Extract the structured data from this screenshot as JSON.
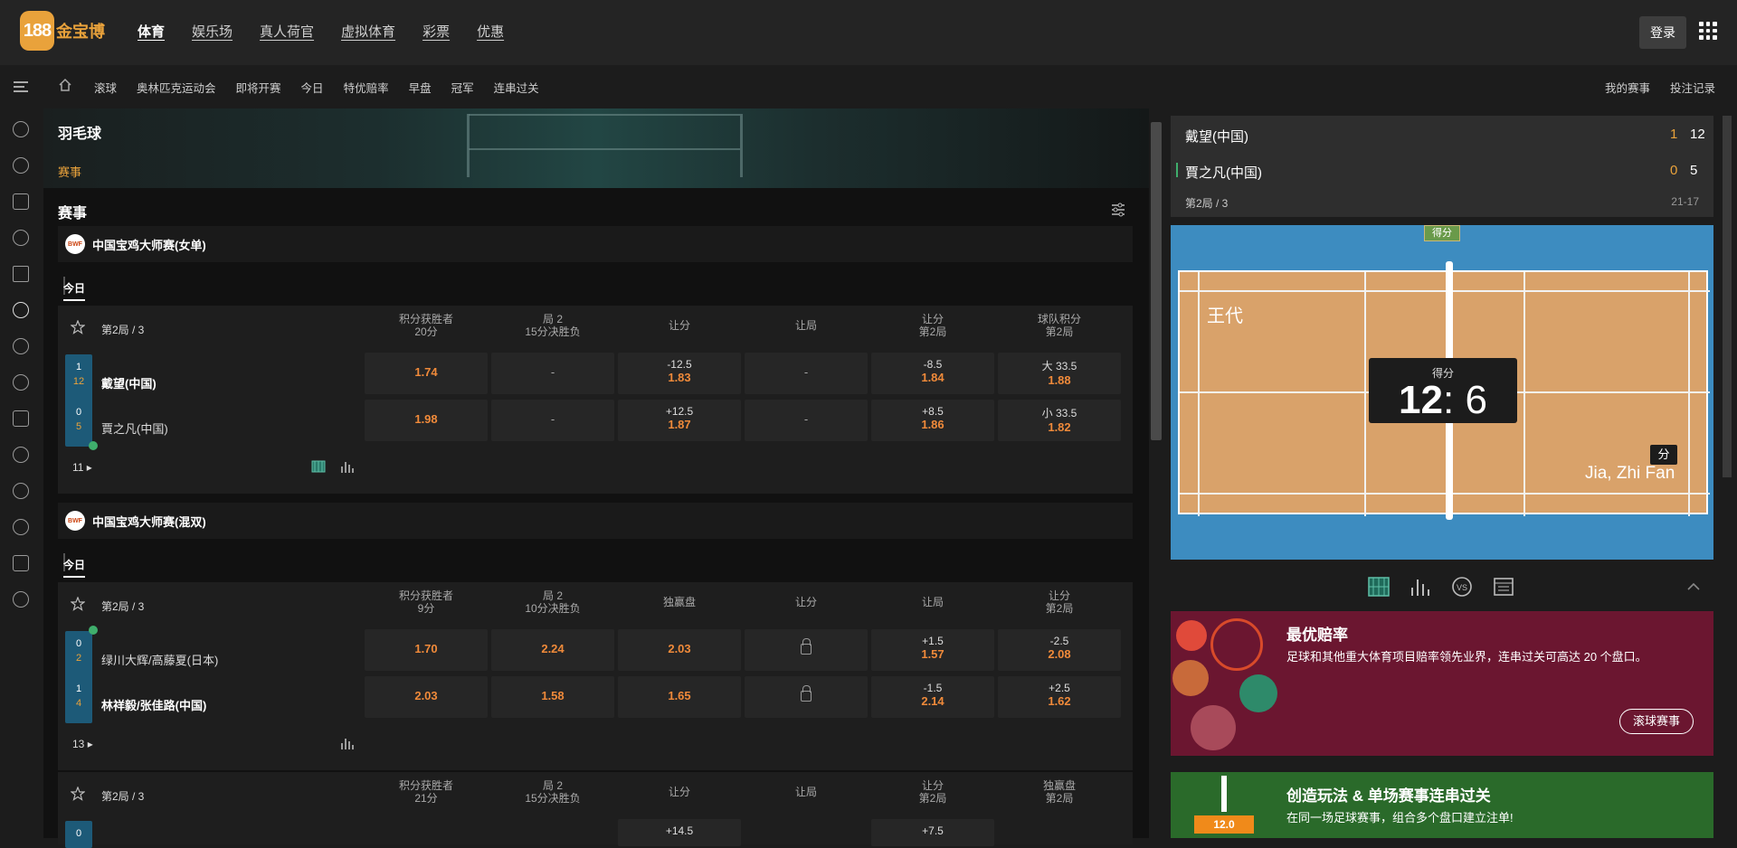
{
  "brand": {
    "badge": "188",
    "name": "金宝博"
  },
  "main_nav": [
    "体育",
    "娱乐场",
    "真人荷官",
    "虚拟体育",
    "彩票",
    "优惠"
  ],
  "login_label": "登录",
  "sub_nav": [
    "滚球",
    "奥林匹克运动会",
    "即将开赛",
    "今日",
    "特优赔率",
    "早盘",
    "冠军",
    "连串过关"
  ],
  "sub_right": [
    "我的赛事",
    "投注记录"
  ],
  "banner": {
    "title": "羽毛球",
    "tag": "赛事"
  },
  "section_title": "赛事",
  "competitions": [
    {
      "logo": "BWF",
      "name": "中国宝鸡大师赛(女单)",
      "day": "今日",
      "match": {
        "period": "第2局 / 3",
        "columns": [
          {
            "l1": "积分获胜者",
            "l2": "20分"
          },
          {
            "l1": "局 2",
            "l2": "15分决胜负"
          },
          {
            "l1": "让分",
            "l2": ""
          },
          {
            "l1": "让局",
            "l2": ""
          },
          {
            "l1": "让分",
            "l2": "第2局"
          },
          {
            "l1": "球队积分",
            "l2": "第2局"
          }
        ],
        "teams": [
          {
            "name": "戴望(中国)",
            "sets": "1",
            "points": "12",
            "cells": [
              {
                "o": "1.74"
              },
              {
                "dash": "-"
              },
              {
                "l": "-12.5",
                "o": "1.83"
              },
              {
                "dash": "-"
              },
              {
                "l": "-8.5",
                "o": "1.84"
              },
              {
                "l": "大 33.5",
                "o": "1.88"
              }
            ]
          },
          {
            "name": "賈之凡(中国)",
            "sets": "0",
            "points": "5",
            "cells": [
              {
                "o": "1.98"
              },
              {
                "dash": "-"
              },
              {
                "l": "+12.5",
                "o": "1.87"
              },
              {
                "dash": "-"
              },
              {
                "l": "+8.5",
                "o": "1.86"
              },
              {
                "l": "小 33.5",
                "o": "1.82"
              }
            ]
          }
        ],
        "more": "11"
      }
    },
    {
      "logo": "BWF",
      "name": "中国宝鸡大师赛(混双)",
      "day": "今日",
      "match": {
        "period": "第2局 / 3",
        "columns": [
          {
            "l1": "积分获胜者",
            "l2": "9分"
          },
          {
            "l1": "局 2",
            "l2": "10分决胜负"
          },
          {
            "l1": "独赢盘",
            "l2": ""
          },
          {
            "l1": "让分",
            "l2": ""
          },
          {
            "l1": "让局",
            "l2": ""
          },
          {
            "l1": "让分",
            "l2": "第2局"
          }
        ],
        "teams": [
          {
            "name": "绿川大辉/高藤夏(日本)",
            "sets": "0",
            "points": "2",
            "cells": [
              {
                "o": "1.70"
              },
              {
                "o": "2.24"
              },
              {
                "o": "2.03"
              },
              {
                "lock": true
              },
              {
                "l": "+1.5",
                "o": "1.57"
              },
              {
                "l": "-2.5",
                "o": "2.08"
              }
            ]
          },
          {
            "name": "林祥毅/张佳路(中国)",
            "sets": "1",
            "points": "4",
            "cells": [
              {
                "o": "2.03"
              },
              {
                "o": "1.58"
              },
              {
                "o": "1.65"
              },
              {
                "lock": true
              },
              {
                "l": "-1.5",
                "o": "2.14"
              },
              {
                "l": "+2.5",
                "o": "1.62"
              }
            ]
          }
        ],
        "more": "13"
      },
      "match2": {
        "period": "第2局 / 3",
        "columns": [
          {
            "l1": "积分获胜者",
            "l2": "21分"
          },
          {
            "l1": "局 2",
            "l2": "15分决胜负"
          },
          {
            "l1": "让分",
            "l2": ""
          },
          {
            "l1": "让局",
            "l2": ""
          },
          {
            "l1": "让分",
            "l2": "第2局"
          },
          {
            "l1": "独赢盘",
            "l2": "第2局"
          }
        ],
        "partial": {
          "sets": "0",
          "l_cell3": "+14.5",
          "l_cell5": "+7.5"
        }
      }
    }
  ],
  "scoreboard": {
    "teams": [
      {
        "name": "戴望(中国)",
        "sets": "1",
        "points": "12"
      },
      {
        "name": "賈之凡(中国)",
        "sets": "0",
        "points": "5"
      }
    ],
    "period": "第2局 / 3",
    "set_score": "21-17"
  },
  "court": {
    "top_tag": "得分",
    "score_label": "得分",
    "score_left": "12",
    "score_sep": ":",
    "score_right": "6",
    "player_left": "王代",
    "player_right": "Jia, Zhi Fan",
    "point_tag": "分"
  },
  "promos": [
    {
      "title": "最优赔率",
      "text": "足球和其他重大体育项目赔率领先业界，连串过关可高达 20 个盘口。",
      "button": "滚球赛事",
      "color": "#6b1630"
    },
    {
      "title": "创造玩法 & 单场赛事连串过关",
      "text": "在同一场足球赛事，组合多个盘口建立注单!",
      "badge": "12.0",
      "color": "#2a6a2a"
    }
  ]
}
